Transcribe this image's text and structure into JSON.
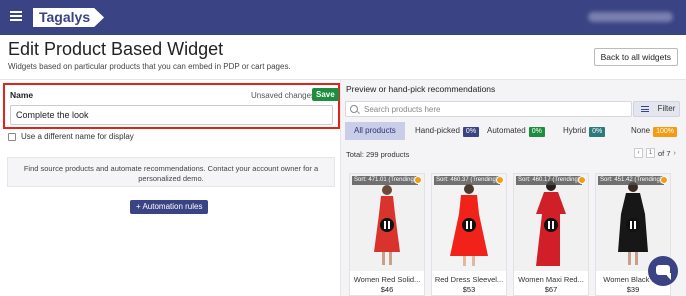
{
  "topbar": {
    "logo_text": "Tagalys",
    "menu_icon": "hamburger-icon"
  },
  "header": {
    "title": "Edit Product Based Widget",
    "subtitle": "Widgets based on particular products that you can embed in PDP or cart pages.",
    "back_label": "Back to all widgets"
  },
  "form": {
    "name_label": "Name",
    "unsaved_label": "Unsaved changes",
    "save_label": "Save",
    "name_value": "Complete the look",
    "checkbox_label": "Use a different name for display",
    "info_text": "Find source products and automate recommendations. Contact your account owner for a personalized demo.",
    "automation_label": "+ Automation rules"
  },
  "preview": {
    "title": "Preview or hand-pick recommendations",
    "search_placeholder": "Search products here",
    "filter_label": "Filter",
    "tabs": [
      {
        "label": "All products",
        "badge": null,
        "badge_color": null
      },
      {
        "label": "Hand-picked",
        "badge": "0%",
        "badge_color": "#3a4383"
      },
      {
        "label": "Automated",
        "badge": "0%",
        "badge_color": "#1e8e3e"
      },
      {
        "label": "Hybrid",
        "badge": "0%",
        "badge_color": "#2c7a7b"
      },
      {
        "label": "None",
        "badge": "100%",
        "badge_color": "#f39c12"
      }
    ],
    "total": "Total: 299 products",
    "page_current": "1",
    "page_of": "of 7",
    "prev_icon": "chevron-left-icon",
    "next_icon": "chevron-right-icon"
  },
  "products": [
    {
      "sort": "Sort: 471.01 (Trending)",
      "name": "Women Red Solid...",
      "price": "$46"
    },
    {
      "sort": "Sort: 460.37 (Trending)",
      "name": "Red Dress Sleevel...",
      "price": "$53"
    },
    {
      "sort": "Sort: 460.17 (Trending)",
      "name": "Women Maxi Red...",
      "price": "$67"
    },
    {
      "sort": "Sort: 451.42 (Trending)",
      "name": "Women Black S...",
      "price": "$39"
    }
  ],
  "colors": {
    "brand": "#3a4383",
    "save": "#1e8e3e",
    "highlight_border": "#e2231a",
    "status_dot": "#f39c12"
  }
}
